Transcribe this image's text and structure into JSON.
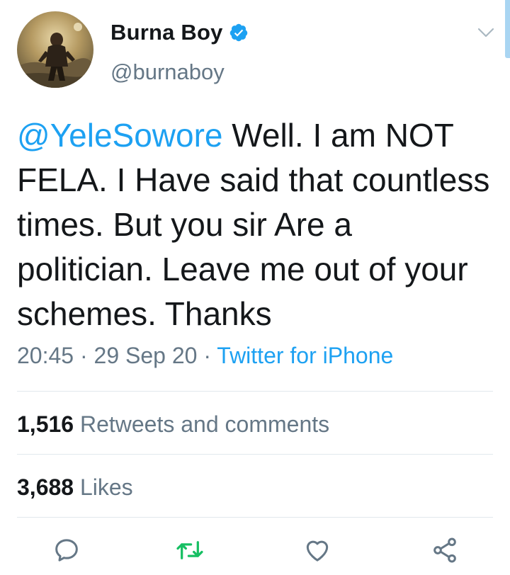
{
  "author": {
    "name": "Burna Boy",
    "handle": "@burnaboy",
    "verified": true,
    "verified_icon": "verified-badge-icon",
    "verified_color": "#1da1f2"
  },
  "tweet": {
    "mention": "@YeleSowore",
    "body": " Well. I am NOT FELA. I Have said that countless times. But you sir Are a politician. Leave me out of your schemes. Thanks",
    "time": "20:45",
    "separator": "·",
    "date": "29 Sep 20",
    "source": "Twitter for iPhone"
  },
  "stats": {
    "retweets_count": "1,516",
    "retweets_label": "Retweets and comments",
    "likes_count": "3,688",
    "likes_label": "Likes"
  },
  "actions": [
    {
      "icon": "reply-icon"
    },
    {
      "icon": "retweet-icon",
      "color": "#17bf63"
    },
    {
      "icon": "like-icon"
    },
    {
      "icon": "share-icon"
    }
  ],
  "colors": {
    "link": "#1da1f2",
    "secondary_text": "#657786",
    "retweet_green": "#17bf63",
    "divider": "#e1e8ed"
  }
}
